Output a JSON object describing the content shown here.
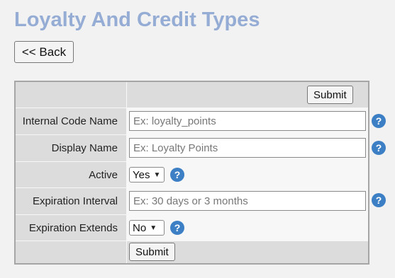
{
  "page": {
    "title": "Loyalty And Credit Types"
  },
  "back_button": {
    "label": "<< Back"
  },
  "form": {
    "top_submit_label": "Submit",
    "bottom_submit_label": "Submit",
    "help_glyph": "?",
    "fields": [
      {
        "label": "Internal Code Name",
        "type": "text",
        "value": "",
        "placeholder": "Ex: loyalty_points"
      },
      {
        "label": "Display Name",
        "type": "text",
        "value": "",
        "placeholder": "Ex: Loyalty Points"
      },
      {
        "label": "Active",
        "type": "select",
        "value": "Yes"
      },
      {
        "label": "Expiration Interval",
        "type": "text",
        "value": "",
        "placeholder": "Ex: 30 days or 3 months"
      },
      {
        "label": "Expiration Extends",
        "type": "select",
        "value": "No"
      }
    ]
  },
  "colors": {
    "title": "#95acd4",
    "help_icon": "#3d7fc4",
    "label_cell_bg": "#dcdcdc"
  },
  "icons": {
    "help": "question-circle-icon",
    "select": "chevron-down-icon"
  }
}
